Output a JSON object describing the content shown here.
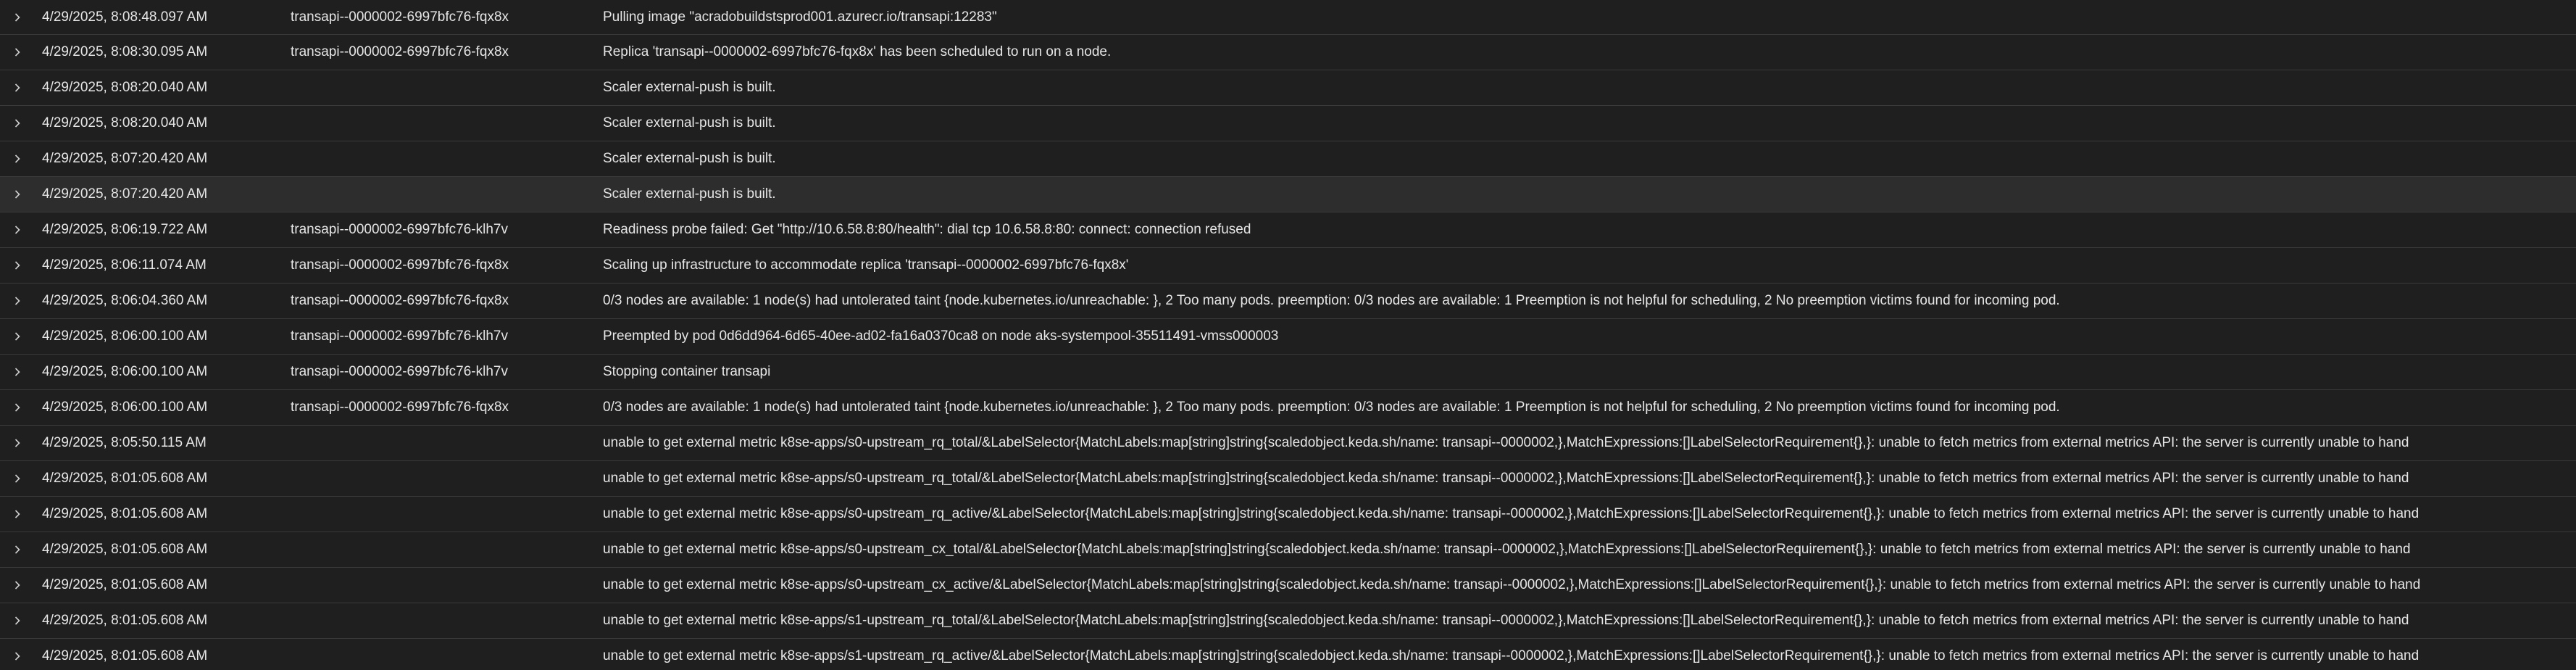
{
  "rows": [
    {
      "time": "4/29/2025, 8:08:48.097 AM",
      "replica": "transapi--0000002-6997bfc76-fqx8x",
      "message": "Pulling image \"acradobuildstsprod001.azurecr.io/transapi:12283\""
    },
    {
      "time": "4/29/2025, 8:08:30.095 AM",
      "replica": "transapi--0000002-6997bfc76-fqx8x",
      "message": "Replica 'transapi--0000002-6997bfc76-fqx8x' has been scheduled to run on a node."
    },
    {
      "time": "4/29/2025, 8:08:20.040 AM",
      "replica": "",
      "message": "Scaler external-push is built."
    },
    {
      "time": "4/29/2025, 8:08:20.040 AM",
      "replica": "",
      "message": "Scaler external-push is built."
    },
    {
      "time": "4/29/2025, 8:07:20.420 AM",
      "replica": "",
      "message": "Scaler external-push is built."
    },
    {
      "time": "4/29/2025, 8:07:20.420 AM",
      "replica": "",
      "message": "Scaler external-push is built.",
      "highlighted": true
    },
    {
      "time": "4/29/2025, 8:06:19.722 AM",
      "replica": "transapi--0000002-6997bfc76-klh7v",
      "message": "Readiness probe failed: Get \"http://10.6.58.8:80/health\": dial tcp 10.6.58.8:80: connect: connection refused"
    },
    {
      "time": "4/29/2025, 8:06:11.074 AM",
      "replica": "transapi--0000002-6997bfc76-fqx8x",
      "message": "Scaling up infrastructure to accommodate replica 'transapi--0000002-6997bfc76-fqx8x'"
    },
    {
      "time": "4/29/2025, 8:06:04.360 AM",
      "replica": "transapi--0000002-6997bfc76-fqx8x",
      "message": "0/3 nodes are available: 1 node(s) had untolerated taint {node.kubernetes.io/unreachable: }, 2 Too many pods. preemption: 0/3 nodes are available: 1 Preemption is not helpful for scheduling, 2 No preemption victims found for incoming pod."
    },
    {
      "time": "4/29/2025, 8:06:00.100 AM",
      "replica": "transapi--0000002-6997bfc76-klh7v",
      "message": "Preempted by pod 0d6dd964-6d65-40ee-ad02-fa16a0370ca8 on node aks-systempool-35511491-vmss000003"
    },
    {
      "time": "4/29/2025, 8:06:00.100 AM",
      "replica": "transapi--0000002-6997bfc76-klh7v",
      "message": "Stopping container transapi"
    },
    {
      "time": "4/29/2025, 8:06:00.100 AM",
      "replica": "transapi--0000002-6997bfc76-fqx8x",
      "message": "0/3 nodes are available: 1 node(s) had untolerated taint {node.kubernetes.io/unreachable: }, 2 Too many pods. preemption: 0/3 nodes are available: 1 Preemption is not helpful for scheduling, 2 No preemption victims found for incoming pod."
    },
    {
      "time": "4/29/2025, 8:05:50.115 AM",
      "replica": "",
      "message": "unable to get external metric k8se-apps/s0-upstream_rq_total/&LabelSelector{MatchLabels:map[string]string{scaledobject.keda.sh/name: transapi--0000002,},MatchExpressions:[]LabelSelectorRequirement{},}: unable to fetch metrics from external metrics API: the server is currently unable to hand"
    },
    {
      "time": "4/29/2025, 8:01:05.608 AM",
      "replica": "",
      "message": "unable to get external metric k8se-apps/s0-upstream_rq_total/&LabelSelector{MatchLabels:map[string]string{scaledobject.keda.sh/name: transapi--0000002,},MatchExpressions:[]LabelSelectorRequirement{},}: unable to fetch metrics from external metrics API: the server is currently unable to hand"
    },
    {
      "time": "4/29/2025, 8:01:05.608 AM",
      "replica": "",
      "message": "unable to get external metric k8se-apps/s0-upstream_rq_active/&LabelSelector{MatchLabels:map[string]string{scaledobject.keda.sh/name: transapi--0000002,},MatchExpressions:[]LabelSelectorRequirement{},}: unable to fetch metrics from external metrics API: the server is currently unable to hand"
    },
    {
      "time": "4/29/2025, 8:01:05.608 AM",
      "replica": "",
      "message": "unable to get external metric k8se-apps/s0-upstream_cx_total/&LabelSelector{MatchLabels:map[string]string{scaledobject.keda.sh/name: transapi--0000002,},MatchExpressions:[]LabelSelectorRequirement{},}: unable to fetch metrics from external metrics API: the server is currently unable to hand"
    },
    {
      "time": "4/29/2025, 8:01:05.608 AM",
      "replica": "",
      "message": "unable to get external metric k8se-apps/s0-upstream_cx_active/&LabelSelector{MatchLabels:map[string]string{scaledobject.keda.sh/name: transapi--0000002,},MatchExpressions:[]LabelSelectorRequirement{},}: unable to fetch metrics from external metrics API: the server is currently unable to hand"
    },
    {
      "time": "4/29/2025, 8:01:05.608 AM",
      "replica": "",
      "message": "unable to get external metric k8se-apps/s1-upstream_rq_total/&LabelSelector{MatchLabels:map[string]string{scaledobject.keda.sh/name: transapi--0000002,},MatchExpressions:[]LabelSelectorRequirement{},}: unable to fetch metrics from external metrics API: the server is currently unable to hand"
    },
    {
      "time": "4/29/2025, 8:01:05.608 AM",
      "replica": "",
      "message": "unable to get external metric k8se-apps/s1-upstream_rq_active/&LabelSelector{MatchLabels:map[string]string{scaledobject.keda.sh/name: transapi--0000002,},MatchExpressions:[]LabelSelectorRequirement{},}: unable to fetch metrics from external metrics API: the server is currently unable to hand"
    }
  ],
  "colors": {
    "background": "#1f1f1f",
    "row_highlight": "#2d2d2d",
    "text": "#e6e6e6",
    "divider": "#3a3a3a"
  },
  "icons": {
    "expand": "chevron-right-icon"
  }
}
